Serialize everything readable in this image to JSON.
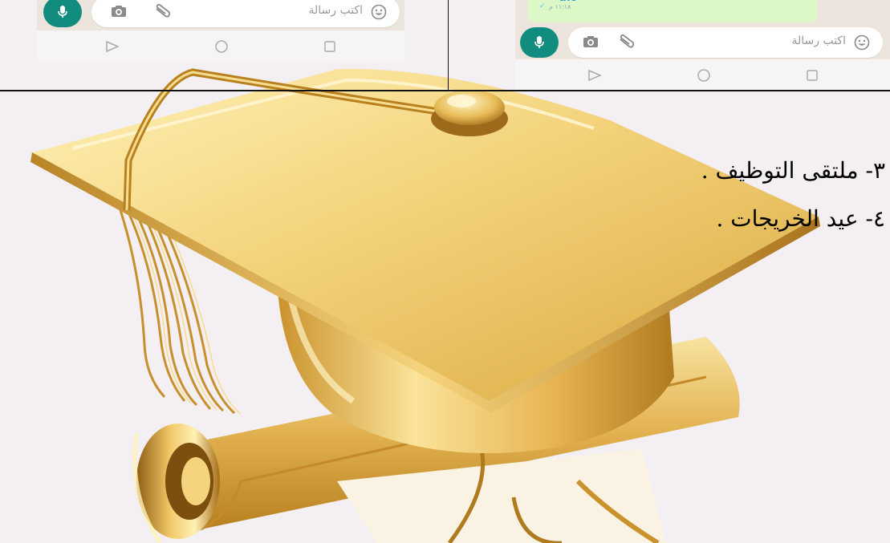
{
  "left_screenshot": {
    "input_placeholder": "اكتب رسالة"
  },
  "right_screenshot": {
    "message_text": "ult",
    "message_time": "١١:١٨ م",
    "input_placeholder": "اكتب رسالة"
  },
  "colors": {
    "mic_button": "#128c7e",
    "bubble": "#dcf8c6",
    "chat_background": "#ece5dd"
  },
  "icons": [
    "mic-icon",
    "camera-icon",
    "paperclip-icon",
    "emoji-icon",
    "nav-back-icon",
    "nav-home-icon",
    "nav-recents-icon"
  ],
  "list_items": [
    {
      "text": "٣- ملتقى التوظيف ."
    },
    {
      "text": "٤- عيد الخريجات ."
    }
  ]
}
